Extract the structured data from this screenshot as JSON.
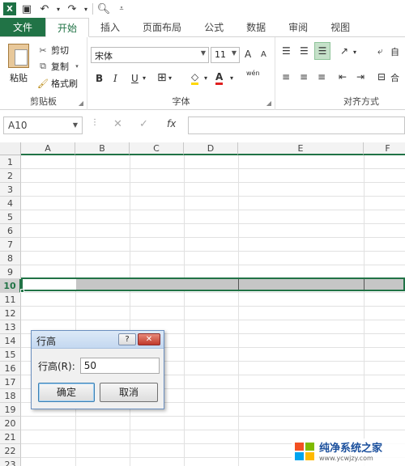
{
  "qat": {
    "app_icon": "X"
  },
  "tabs": [
    "文件",
    "开始",
    "插入",
    "页面布局",
    "公式",
    "数据",
    "审阅",
    "视图"
  ],
  "ribbon": {
    "clipboard": {
      "paste": "粘贴",
      "cut": "剪切",
      "copy": "复制",
      "format_painter": "格式刷",
      "group_label": "剪贴板"
    },
    "font": {
      "font_name": "宋体",
      "font_size": "11",
      "bold": "B",
      "italic": "I",
      "underline": "U",
      "group_label": "字体",
      "grow": "A",
      "shrink": "A",
      "phonetic": "wén"
    },
    "alignment": {
      "group_label": "对齐方式",
      "wrap": "自",
      "merge": "合"
    }
  },
  "formula_bar": {
    "name_box": "A10",
    "fx": "fx",
    "formula": ""
  },
  "columns": [
    "A",
    "B",
    "C",
    "D",
    "E",
    "F"
  ],
  "rows": [
    "1",
    "2",
    "3",
    "4",
    "5",
    "6",
    "7",
    "8",
    "9",
    "10",
    "11",
    "12",
    "13",
    "14",
    "15",
    "16",
    "17",
    "18",
    "19",
    "20",
    "21",
    "22",
    "23"
  ],
  "selected_row": "10",
  "dialog": {
    "title": "行高",
    "question": "?",
    "close": "✕",
    "label": "行高(R):",
    "value": "50",
    "ok": "确定",
    "cancel": "取消"
  },
  "watermark": {
    "title": "纯净系统之家",
    "url": "www.ycwjzy.com"
  },
  "colors": {
    "accent": "#217346",
    "dialog_border": "#6b8fbf"
  }
}
